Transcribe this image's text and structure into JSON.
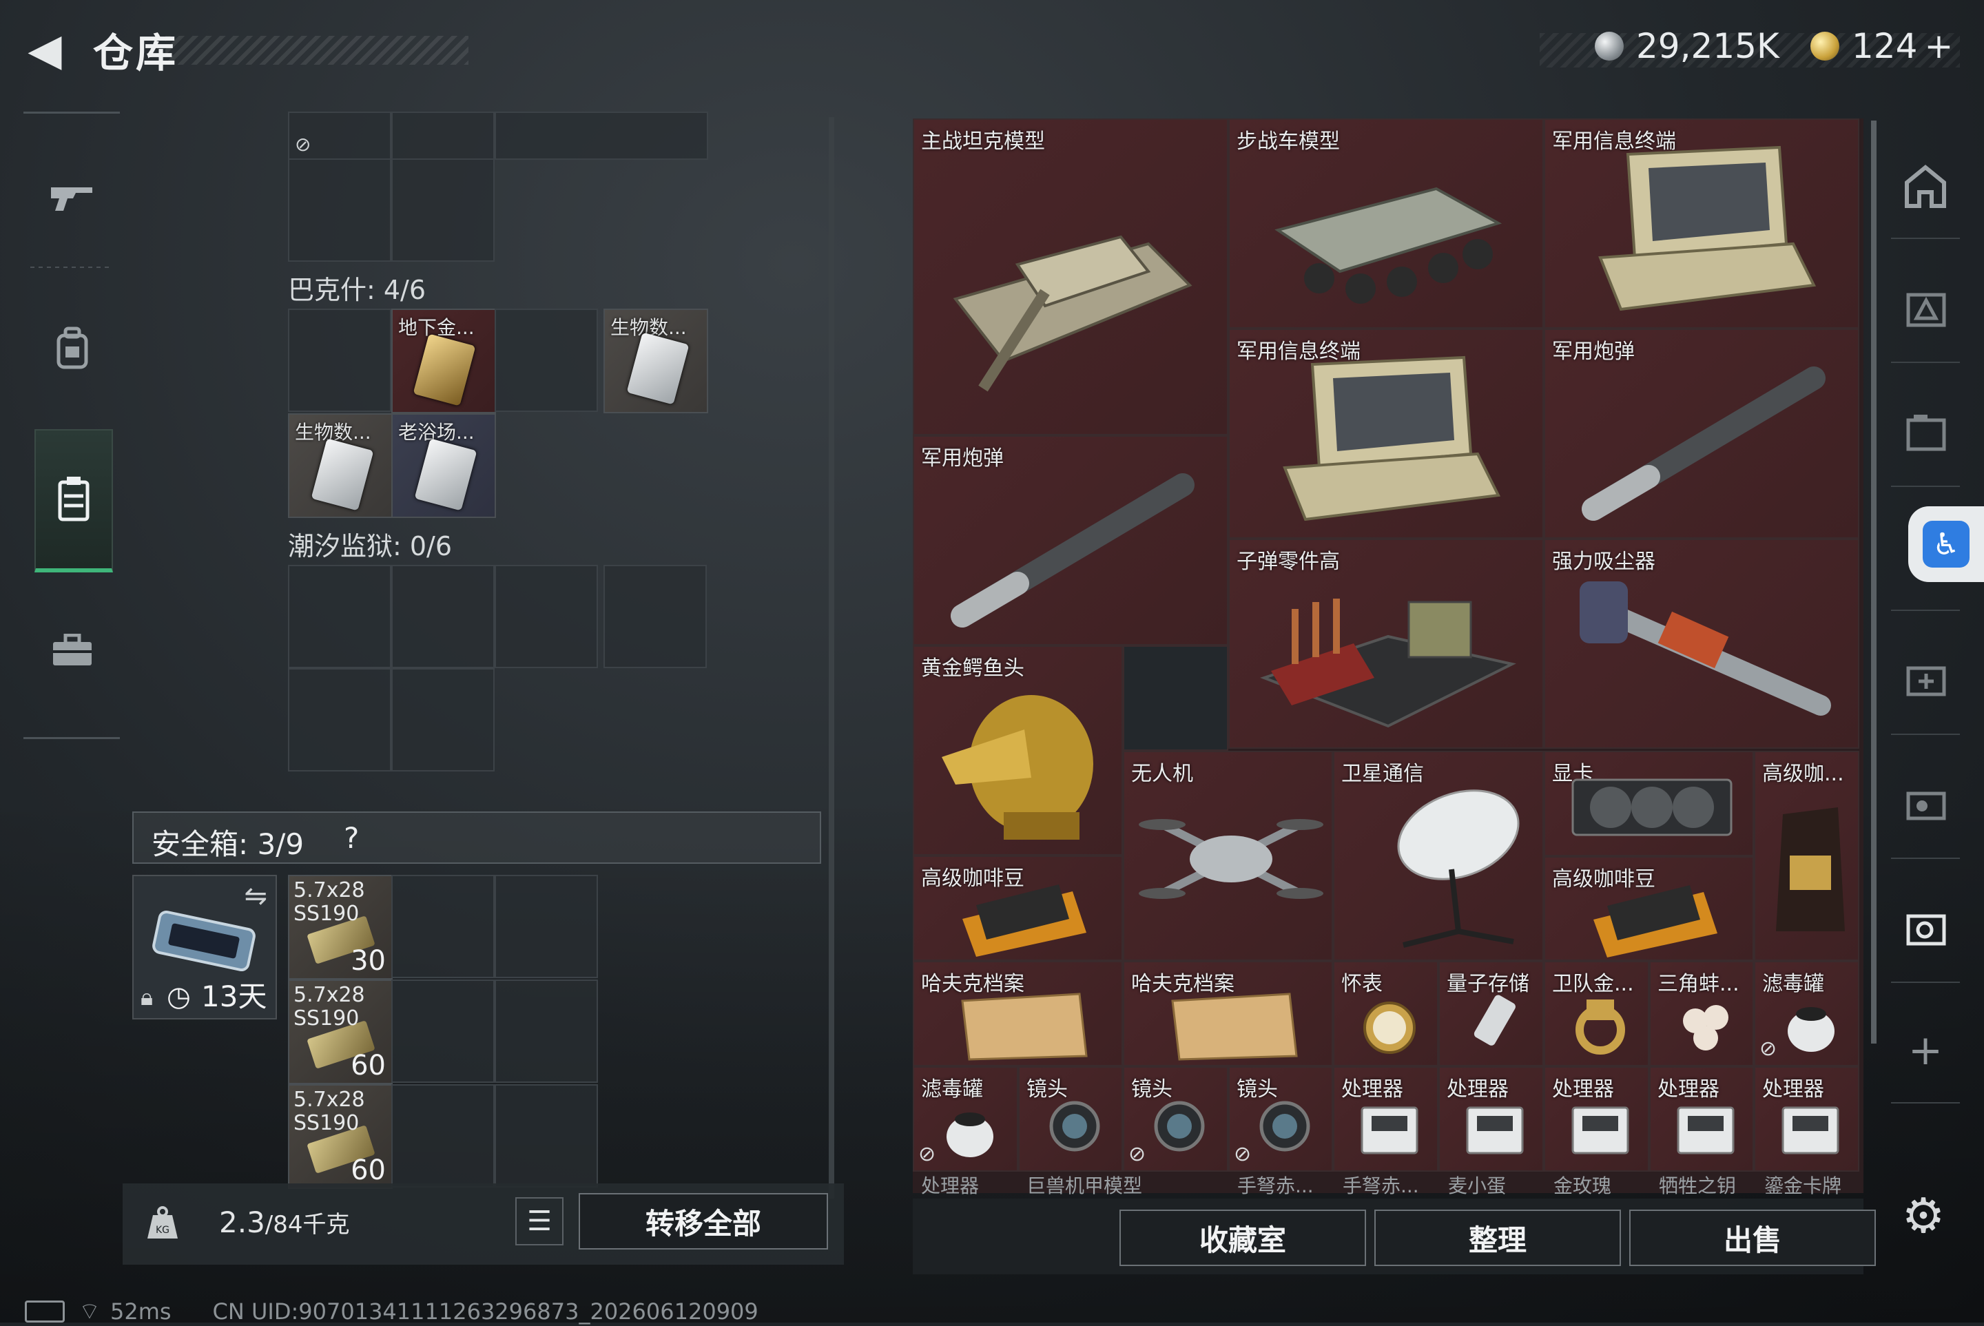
{
  "header": {
    "back_glyph": "◀",
    "title": "仓库",
    "silver_amount": "29,215K",
    "gold_amount": "124",
    "gold_plus": "+"
  },
  "left_nav": [
    {
      "name": "weapon-icon",
      "glyph": "⌐"
    },
    {
      "name": "backpack-icon",
      "glyph": "⛭"
    },
    {
      "name": "vest-icon",
      "glyph": "▤"
    },
    {
      "name": "briefcase-icon",
      "glyph": "▬"
    }
  ],
  "sections": {
    "bakesh": "巴克什: 4/6",
    "tide_prison": "潮汐监狱: 0/6"
  },
  "collection_cards": [
    {
      "label": "地下金..."
    },
    {
      "label": "生物数..."
    },
    {
      "label": "生物数..."
    },
    {
      "label": "老浴场..."
    }
  ],
  "safebox": {
    "label": "安全箱: 3/9",
    "help": "?",
    "case_timer": "13天",
    "ammo": [
      {
        "name": "5.7x28\nSS190",
        "count": "30"
      },
      {
        "name": "5.7x28\nSS190",
        "count": "60"
      },
      {
        "name": "5.7x28\nSS190",
        "count": "60"
      }
    ]
  },
  "weight": {
    "icon_text": "KG",
    "value": "2.3",
    "max": "/84千克",
    "transfer_all": "转移全部"
  },
  "status": {
    "ping": "52ms",
    "uid": "CN UID:9070134111126329687​3_202606120909"
  },
  "stash_items": [
    {
      "label": "主战坦克模型"
    },
    {
      "label": "步战车模型"
    },
    {
      "label": "军用信息终端"
    },
    {
      "label": "军用信息终端"
    },
    {
      "label": "军用炮弹"
    },
    {
      "label": "军用炮弹"
    },
    {
      "label": "子弹零件高"
    },
    {
      "label": "强力吸尘器"
    },
    {
      "label": "黄金鳄鱼头"
    },
    {
      "label": "无人机"
    },
    {
      "label": "卫星通信"
    },
    {
      "label": "显卡"
    },
    {
      "label": "高级咖..."
    },
    {
      "label": "高级咖啡豆"
    },
    {
      "label": "高级咖啡豆"
    },
    {
      "label": "哈夫克档案"
    },
    {
      "label": "哈夫克档案"
    },
    {
      "label": "怀表"
    },
    {
      "label": "量子存储"
    },
    {
      "label": "卫队金..."
    },
    {
      "label": "三角蚌..."
    },
    {
      "label": "滤毒罐"
    },
    {
      "label": "滤毒罐"
    },
    {
      "label": "镜头"
    },
    {
      "label": "镜头"
    },
    {
      "label": "镜头"
    },
    {
      "label": "处理器"
    },
    {
      "label": "处理器"
    },
    {
      "label": "处理器"
    },
    {
      "label": "处理器"
    },
    {
      "label": "处理器"
    }
  ],
  "bottom_row_labels": [
    "处理器",
    "巨兽机甲模型",
    "",
    "手弩赤...",
    "手弩赤...",
    "麦小蛋",
    "金玫瑰",
    "牺牲之钥",
    "鎏金卡牌"
  ],
  "right_footer": {
    "collection_room": "收藏室",
    "organize": "整理",
    "sell": "出售"
  },
  "right_rail": {
    "plus": "+",
    "settings_glyph": "⚙",
    "accessibility_glyph": "♿"
  },
  "colors": {
    "accent_green": "#3fb67a",
    "valuable_red": "#4a2629",
    "access_blue": "#2f7de1"
  }
}
